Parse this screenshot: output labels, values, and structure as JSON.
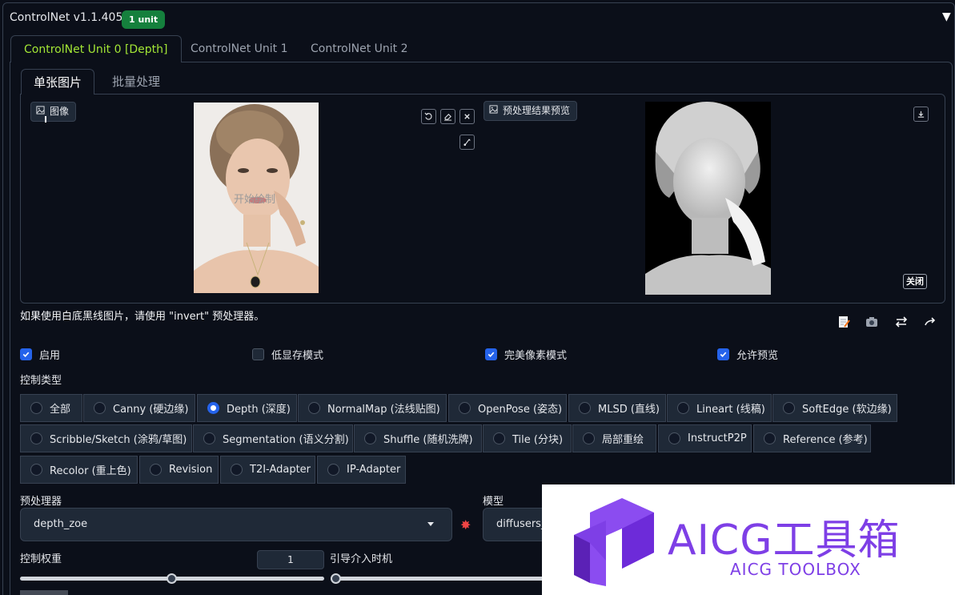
{
  "header": {
    "title": "ControlNet v1.1.405",
    "badge": "1 unit",
    "collapse_icon": "triangle-down-icon"
  },
  "unit_tabs": [
    {
      "label": "ControlNet Unit 0 [Depth]",
      "active": true
    },
    {
      "label": "ControlNet Unit 1",
      "active": false
    },
    {
      "label": "ControlNet Unit 2",
      "active": false
    }
  ],
  "sub_tabs": [
    {
      "label": "单张图片",
      "active": true
    },
    {
      "label": "批量处理",
      "active": false
    }
  ],
  "image_input": {
    "label": "图像",
    "overlay_text": "开始绘制",
    "tools": [
      "undo-icon",
      "eraser-icon",
      "close-icon",
      "brush-icon"
    ]
  },
  "preview": {
    "label": "预处理结果预览",
    "download_icon": "download-icon",
    "close_label": "关闭"
  },
  "hint": "如果使用白底黑线图片，请使用 \"invert\" 预处理器。",
  "actions": [
    "edit-icon",
    "camera-icon",
    "swap-icon",
    "send-icon"
  ],
  "checkboxes": [
    {
      "label": "启用",
      "checked": true
    },
    {
      "label": "低显存模式",
      "checked": false
    },
    {
      "label": "完美像素模式",
      "checked": true
    },
    {
      "label": "允许预览",
      "checked": true
    }
  ],
  "control_type": {
    "label": "控制类型",
    "options": [
      {
        "label": "全部",
        "selected": false
      },
      {
        "label": "Canny (硬边缘)",
        "selected": false
      },
      {
        "label": "Depth (深度)",
        "selected": true
      },
      {
        "label": "NormalMap (法线贴图)",
        "selected": false
      },
      {
        "label": "OpenPose (姿态)",
        "selected": false
      },
      {
        "label": "MLSD (直线)",
        "selected": false
      },
      {
        "label": "Lineart (线稿)",
        "selected": false
      },
      {
        "label": "SoftEdge (软边缘)",
        "selected": false
      },
      {
        "label": "Scribble/Sketch (涂鸦/草图)",
        "selected": false
      },
      {
        "label": "Segmentation (语义分割)",
        "selected": false
      },
      {
        "label": "Shuffle (随机洗牌)",
        "selected": false
      },
      {
        "label": "Tile (分块)",
        "selected": false
      },
      {
        "label": "局部重绘",
        "selected": false
      },
      {
        "label": "InstructP2P",
        "selected": false
      },
      {
        "label": "Reference (参考)",
        "selected": false
      },
      {
        "label": "Recolor (重上色)",
        "selected": false
      },
      {
        "label": "Revision",
        "selected": false
      },
      {
        "label": "T2I-Adapter",
        "selected": false
      },
      {
        "label": "IP-Adapter",
        "selected": false
      }
    ]
  },
  "preprocessor": {
    "label": "预处理器",
    "value": "depth_zoe",
    "run_icon": "explosion-icon"
  },
  "model": {
    "label": "模型",
    "value": "diffusers_"
  },
  "weight": {
    "label": "控制权重",
    "value": "1",
    "slider_fraction": 0.5
  },
  "guidance": {
    "label": "引导介入时机",
    "slider_fraction": 0.0
  },
  "watermark": {
    "title": "AICG工具箱",
    "subtitle": "AICG TOOLBOX",
    "color": "#7e3fe6"
  },
  "colors": {
    "accent_green": "#a3e635",
    "badge_green": "#15803d",
    "check_blue": "#2563eb",
    "background": "#0b0f19"
  }
}
